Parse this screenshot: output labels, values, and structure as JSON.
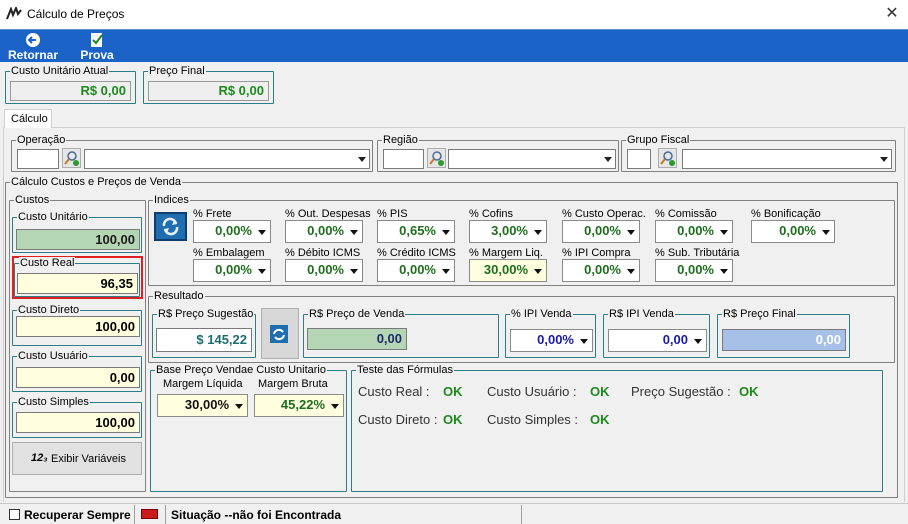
{
  "window": {
    "title": "Cálculo de Preços",
    "close_symbol": "✕"
  },
  "toolbar": {
    "back_label": "Retornar",
    "prova_label": "Prova"
  },
  "summary": {
    "custo_unitario_atual_label": "Custo Unitário Atual",
    "custo_unitario_atual_value": "R$ 0,00",
    "preco_final_label": "Preço Final",
    "preco_final_value": "R$ 0,00"
  },
  "tab": {
    "label": "Cálculo"
  },
  "filters": {
    "operacao_label": "Operação",
    "regiao_label": "Região",
    "grupo_fiscal_label": "Grupo Fiscal"
  },
  "calculo": {
    "title": "Cálculo Custos e Preços de Venda",
    "custos": {
      "title": "Custos",
      "custo_unitario_label": "Custo Unitário",
      "custo_unitario_value": "100,00",
      "custo_real_label": "Custo Real",
      "custo_real_value": "96,35",
      "custo_direto_label": "Custo Direto",
      "custo_direto_value": "100,00",
      "custo_usuario_label": "Custo Usuário",
      "custo_usuario_value": "0,00",
      "custo_simples_label": "Custo Simples",
      "custo_simples_value": "100,00",
      "exibir_variaveis_label": "Exibir Variáveis",
      "exibir_variaveis_icon_text": "12₃"
    },
    "indices": {
      "title": "Indices",
      "row1": [
        {
          "label": "% Frete",
          "value": "0,00%"
        },
        {
          "label": "% Out. Despesas",
          "value": "0,00%"
        },
        {
          "label": "% PIS",
          "value": "0,65%"
        },
        {
          "label": "% Cofins",
          "value": "3,00%"
        },
        {
          "label": "% Custo Operac.",
          "value": "0,00%"
        },
        {
          "label": "% Comissão",
          "value": "0,00%"
        },
        {
          "label": "% Bonificação",
          "value": "0,00%"
        }
      ],
      "row2": [
        {
          "label": "% Embalagem",
          "value": "0,00%"
        },
        {
          "label": "% Débito ICMS",
          "value": "0,00%"
        },
        {
          "label": "% Crédito ICMS",
          "value": "0,00%"
        },
        {
          "label": "% Margem Liq.",
          "value": "30,00%"
        },
        {
          "label": "% IPI Compra",
          "value": "0,00%"
        },
        {
          "label": "% Sub. Tributária",
          "value": "0,00%"
        }
      ]
    },
    "resultado": {
      "title": "Resultado",
      "preco_sugestao_label": "R$ Preço Sugestão",
      "preco_sugestao_value": "$ 145,22",
      "preco_venda_label": "R$ Preço de Venda",
      "preco_venda_value": "0,00",
      "ipi_venda_pct_label": "% IPI Venda",
      "ipi_venda_pct_value": "0,00%",
      "ipi_venda_rs_label": "R$ IPI Venda",
      "ipi_venda_rs_value": "0,00",
      "preco_final_label": "R$ Preço Final",
      "preco_final_value": "0,00"
    },
    "base": {
      "title": "Base Preço Vendae Custo Unitario",
      "margem_liquida_label": "Margem Líquida",
      "margem_liquida_value": "30,00%",
      "margem_bruta_label": "Margem Bruta",
      "margem_bruta_value": "45,22%"
    },
    "teste": {
      "title": "Teste das Fórmulas",
      "custo_real_label": "Custo Real  :",
      "custo_real_status": "OK",
      "custo_usuario_label": "Custo Usuário :",
      "custo_usuario_status": "OK",
      "preco_sugestao_label": "Preço Sugestão :",
      "preco_sugestao_status": "OK",
      "custo_direto_label": "Custo Direto :",
      "custo_direto_status": "OK",
      "custo_simples_label": "Custo Simples :",
      "custo_simples_status": "OK"
    }
  },
  "statusbar": {
    "recuperar_label": "Recuperar Sempre",
    "situacao_text": "Situação --não foi Encontrada"
  }
}
